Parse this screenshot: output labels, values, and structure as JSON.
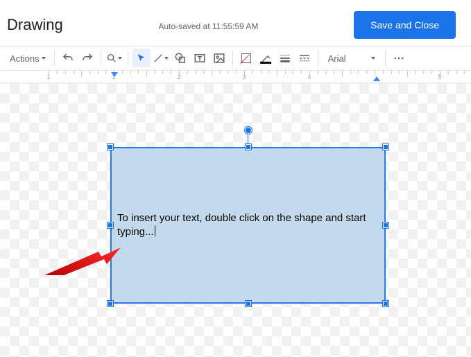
{
  "header": {
    "title": "Drawing",
    "autosave": "Auto-saved at 11:55:59 AM",
    "save_btn": "Save and Close"
  },
  "toolbar": {
    "actions_label": "Actions",
    "font_label": "Arial"
  },
  "ruler": {
    "numbers": [
      "1",
      "1",
      "2",
      "3",
      "4",
      "5"
    ]
  },
  "shape": {
    "text": "To insert your text, double click on the shape and start typing..."
  }
}
